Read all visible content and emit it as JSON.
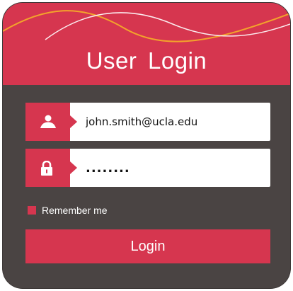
{
  "title": "User Login",
  "username": {
    "value": "john.smith@ucla.edu",
    "icon": "user-icon"
  },
  "password": {
    "value": "........",
    "icon": "lock-icon"
  },
  "remember": {
    "label": "Remember me",
    "checked": false
  },
  "login_button": {
    "label": "Login"
  },
  "colors": {
    "accent": "#d6364f",
    "panel": "#4a4443",
    "wave_light": "#ffffff",
    "wave_gold": "#f3a32b"
  }
}
